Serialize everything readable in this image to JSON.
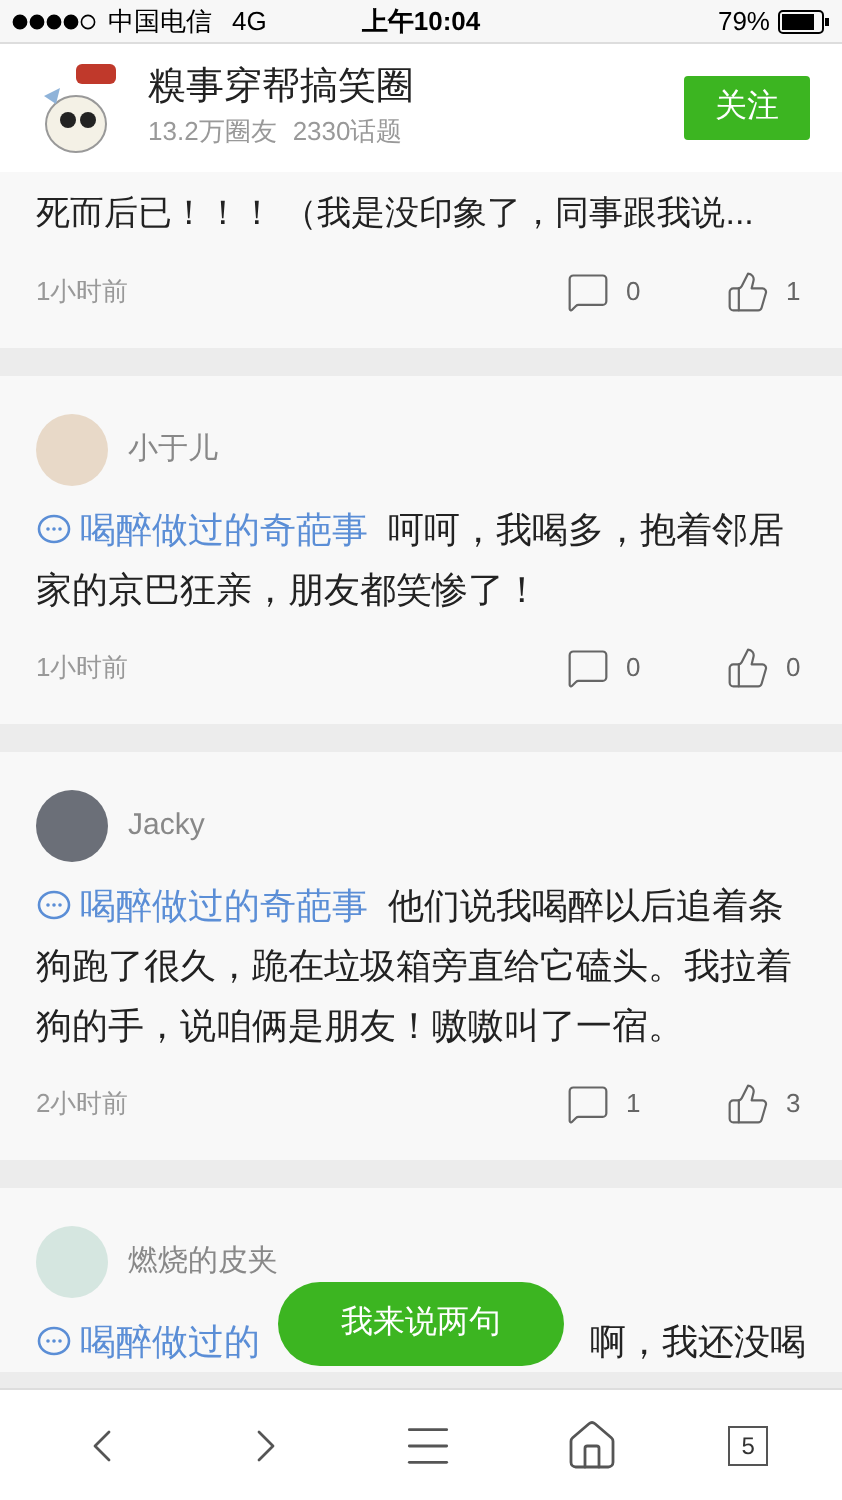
{
  "status_bar": {
    "carrier": "中国电信",
    "network": "4G",
    "time": "上午10:04",
    "battery": "79%"
  },
  "header": {
    "title": "糗事穿帮搞笑圈",
    "members": "13.2万圈友",
    "topics": "2330话题",
    "follow_button": "关注"
  },
  "posts": [
    {
      "text": "死而后已！！！ （我是没印象了，同事跟我说...",
      "time": "1小时前",
      "comments": "0",
      "likes": "1"
    },
    {
      "author": "小于儿",
      "tag": "喝醉做过的奇葩事",
      "text": "呵呵，我喝多，抱着邻居家的京巴狂亲，朋友都笑惨了！",
      "time": "1小时前",
      "comments": "0",
      "likes": "0"
    },
    {
      "author": "Jacky",
      "tag": "喝醉做过的奇葩事",
      "text": "他们说我喝醉以后追着条狗跑了很久，跪在垃圾箱旁直给它磕头。我拉着狗的手，说咱俩是朋友！嗷嗷叫了一宿。",
      "time": "2小时前",
      "comments": "1",
      "likes": "3"
    },
    {
      "author": "燃烧的皮夹",
      "tag": "喝醉做过的",
      "text": "啊，我还没喝"
    }
  ],
  "floating_button": "我来说两句",
  "nav": {
    "tab_count": "5"
  }
}
